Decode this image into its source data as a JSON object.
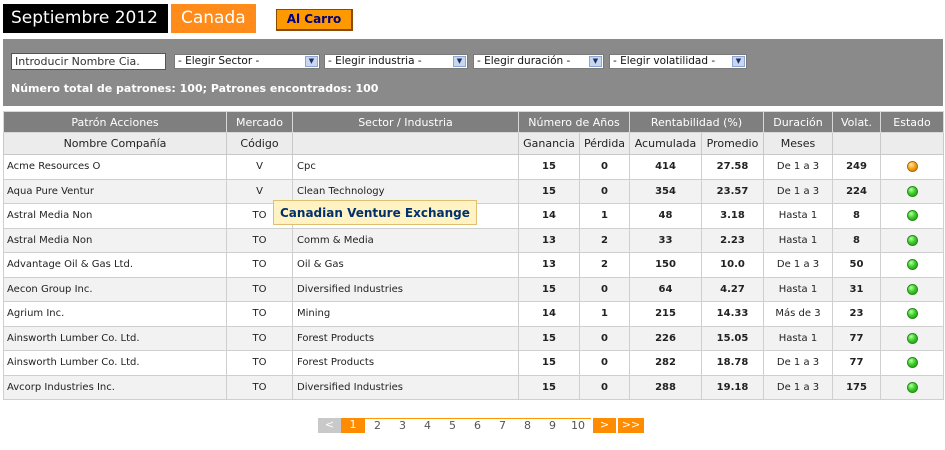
{
  "header": {
    "month": "Septiembre 2012",
    "country": "Canada",
    "cart_button": "Al Carro"
  },
  "filters": {
    "search_value": "Introducir Nombre Cia.",
    "sector": "- Elegir Sector -",
    "industry": "- Elegir industria -",
    "duration": "- Elegir duración -",
    "volatility": "- Elegir volatilidad -",
    "totals": "Número total de patrones: 100;  Patrones encontrados: 100"
  },
  "table": {
    "head1": {
      "pattern": "Patrón Acciones",
      "market": "Mercado",
      "sector": "Sector / Industria",
      "years": "Número de Años",
      "profit": "Rentabilidad (%)",
      "duration": "Duración",
      "volat": "Volat.",
      "status": "Estado"
    },
    "head2": {
      "company": "Nombre Compañía",
      "code": "Código",
      "gain": "Ganancia",
      "loss": "Pérdida",
      "accum": "Acumulada",
      "avg": "Promedio",
      "months": "Meses"
    },
    "rows": [
      {
        "name": "Acme Resources O",
        "code": "V",
        "sector": "Cpc",
        "gain": "15",
        "loss": "0",
        "accum": "414",
        "avg": "27.58",
        "dur": "De 1 a 3",
        "vol": "249",
        "status": "orange"
      },
      {
        "name": "Aqua Pure Ventur",
        "code": "V",
        "sector": "Clean Technology",
        "gain": "15",
        "loss": "0",
        "accum": "354",
        "avg": "23.57",
        "dur": "De 1 a 3",
        "vol": "224",
        "status": "green"
      },
      {
        "name": "Astral Media Non",
        "code": "TO",
        "sector": "",
        "gain": "14",
        "loss": "1",
        "accum": "48",
        "avg": "3.18",
        "dur": "Hasta 1",
        "vol": "8",
        "status": "green"
      },
      {
        "name": "Astral Media Non",
        "code": "TO",
        "sector": "Comm & Media",
        "gain": "13",
        "loss": "2",
        "accum": "33",
        "avg": "2.23",
        "dur": "Hasta 1",
        "vol": "8",
        "status": "green"
      },
      {
        "name": "Advantage Oil & Gas Ltd.",
        "code": "TO",
        "sector": "Oil & Gas",
        "gain": "13",
        "loss": "2",
        "accum": "150",
        "avg": "10.0",
        "dur": "De 1 a 3",
        "vol": "50",
        "status": "green"
      },
      {
        "name": "Aecon Group Inc.",
        "code": "TO",
        "sector": "Diversified Industries",
        "gain": "15",
        "loss": "0",
        "accum": "64",
        "avg": "4.27",
        "dur": "Hasta 1",
        "vol": "31",
        "status": "green"
      },
      {
        "name": "Agrium Inc.",
        "code": "TO",
        "sector": "Mining",
        "gain": "14",
        "loss": "1",
        "accum": "215",
        "avg": "14.33",
        "dur": "Más de 3",
        "vol": "23",
        "status": "green"
      },
      {
        "name": "Ainsworth Lumber Co. Ltd.",
        "code": "TO",
        "sector": "Forest Products",
        "gain": "15",
        "loss": "0",
        "accum": "226",
        "avg": "15.05",
        "dur": "Hasta 1",
        "vol": "77",
        "status": "green"
      },
      {
        "name": "Ainsworth Lumber Co. Ltd.",
        "code": "TO",
        "sector": "Forest Products",
        "gain": "15",
        "loss": "0",
        "accum": "282",
        "avg": "18.78",
        "dur": "De 1 a 3",
        "vol": "77",
        "status": "green"
      },
      {
        "name": "Avcorp Industries Inc.",
        "code": "TO",
        "sector": "Diversified Industries",
        "gain": "15",
        "loss": "0",
        "accum": "288",
        "avg": "19.18",
        "dur": "De 1 a 3",
        "vol": "175",
        "status": "green"
      }
    ]
  },
  "tooltip": "Canadian Venture Exchange",
  "pagination": {
    "prev": "<",
    "pages": [
      "1",
      "2",
      "3",
      "4",
      "5",
      "6",
      "7",
      "8",
      "9",
      "10"
    ],
    "current": "1",
    "next": ">",
    "last": ">>"
  }
}
